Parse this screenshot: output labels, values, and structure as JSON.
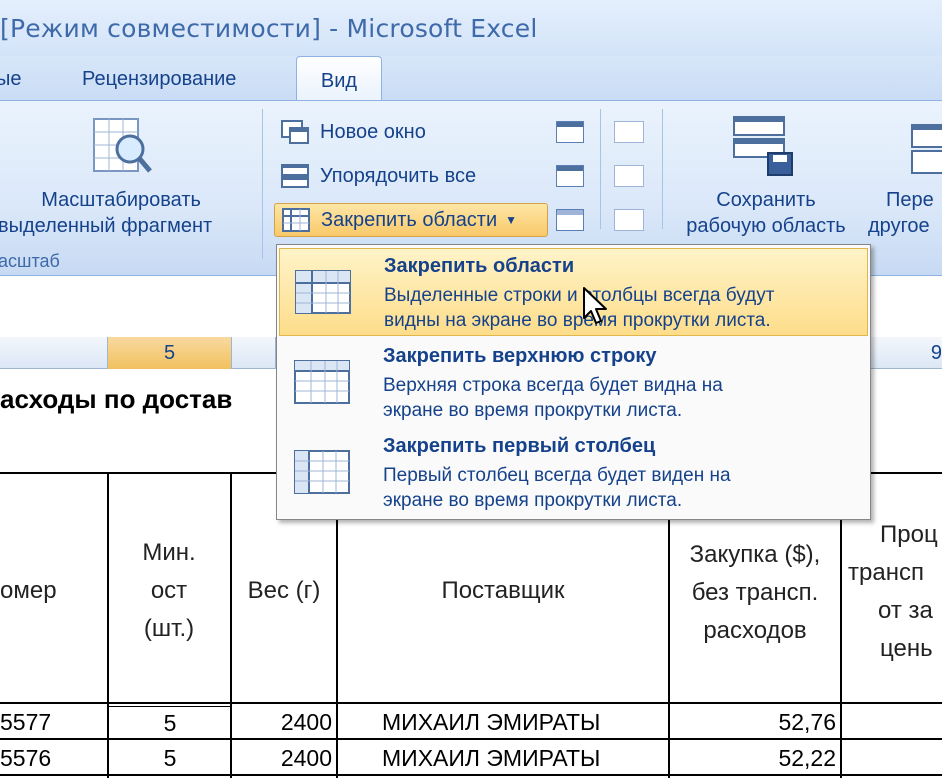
{
  "window": {
    "title": "[Режим совместимости] - Microsoft Excel"
  },
  "tabs": {
    "prev_partial": "ые",
    "review": "Рецензирование",
    "view": "Вид"
  },
  "ribbon": {
    "zoom_selection": {
      "line1": "Масштабировать",
      "line2": "выделенный фрагмент"
    },
    "zoom_group_label": "асштаб",
    "new_window": "Новое окно",
    "arrange_all": "Упорядочить все",
    "freeze_panes": "Закрепить области",
    "save_workspace": {
      "line1": "Сохранить",
      "line2": "рабочую область"
    },
    "switch_windows": {
      "line1": "Пере",
      "line2": "другое"
    }
  },
  "column_headers": {
    "col5": "5",
    "col9": "9"
  },
  "menu": {
    "items": [
      {
        "title": "Закрепить области",
        "desc1": "Выделенные строки и столбцы всегда будут",
        "desc2": "видны на экране во время прокрутки листа.",
        "icon": "freeze-panes-icon"
      },
      {
        "title": "Закрепить верхнюю строку",
        "desc1": "Верхняя строка всегда будет видна на",
        "desc2": "экране во время прокрутки листа.",
        "icon": "freeze-top-row-icon"
      },
      {
        "title": "Закрепить первый столбец",
        "desc1": "Первый столбец всегда будет виден на",
        "desc2": "экране во время прокрутки листа.",
        "icon": "freeze-first-column-icon"
      }
    ]
  },
  "sheet": {
    "title": "асходы по достав",
    "headers": {
      "number": "омер",
      "min_stock": [
        "Мин.",
        "ост",
        "(шт.)"
      ],
      "weight": "Вес (г)",
      "supplier": "Поставщик",
      "purchase": [
        "Закупка ($),",
        "без трансп.",
        "расходов"
      ],
      "percent": [
        "Проц",
        "трансп",
        "от за",
        "цень"
      ]
    },
    "rows": [
      {
        "number": "5577",
        "min_stock": "5",
        "weight": "2400",
        "supplier": "МИХАИЛ ЭМИРАТЫ",
        "purchase": "52,76"
      },
      {
        "number": "5576",
        "min_stock": "5",
        "weight": "2400",
        "supplier": "МИХАИЛ ЭМИРАТЫ",
        "purchase": "52,22"
      }
    ]
  }
}
